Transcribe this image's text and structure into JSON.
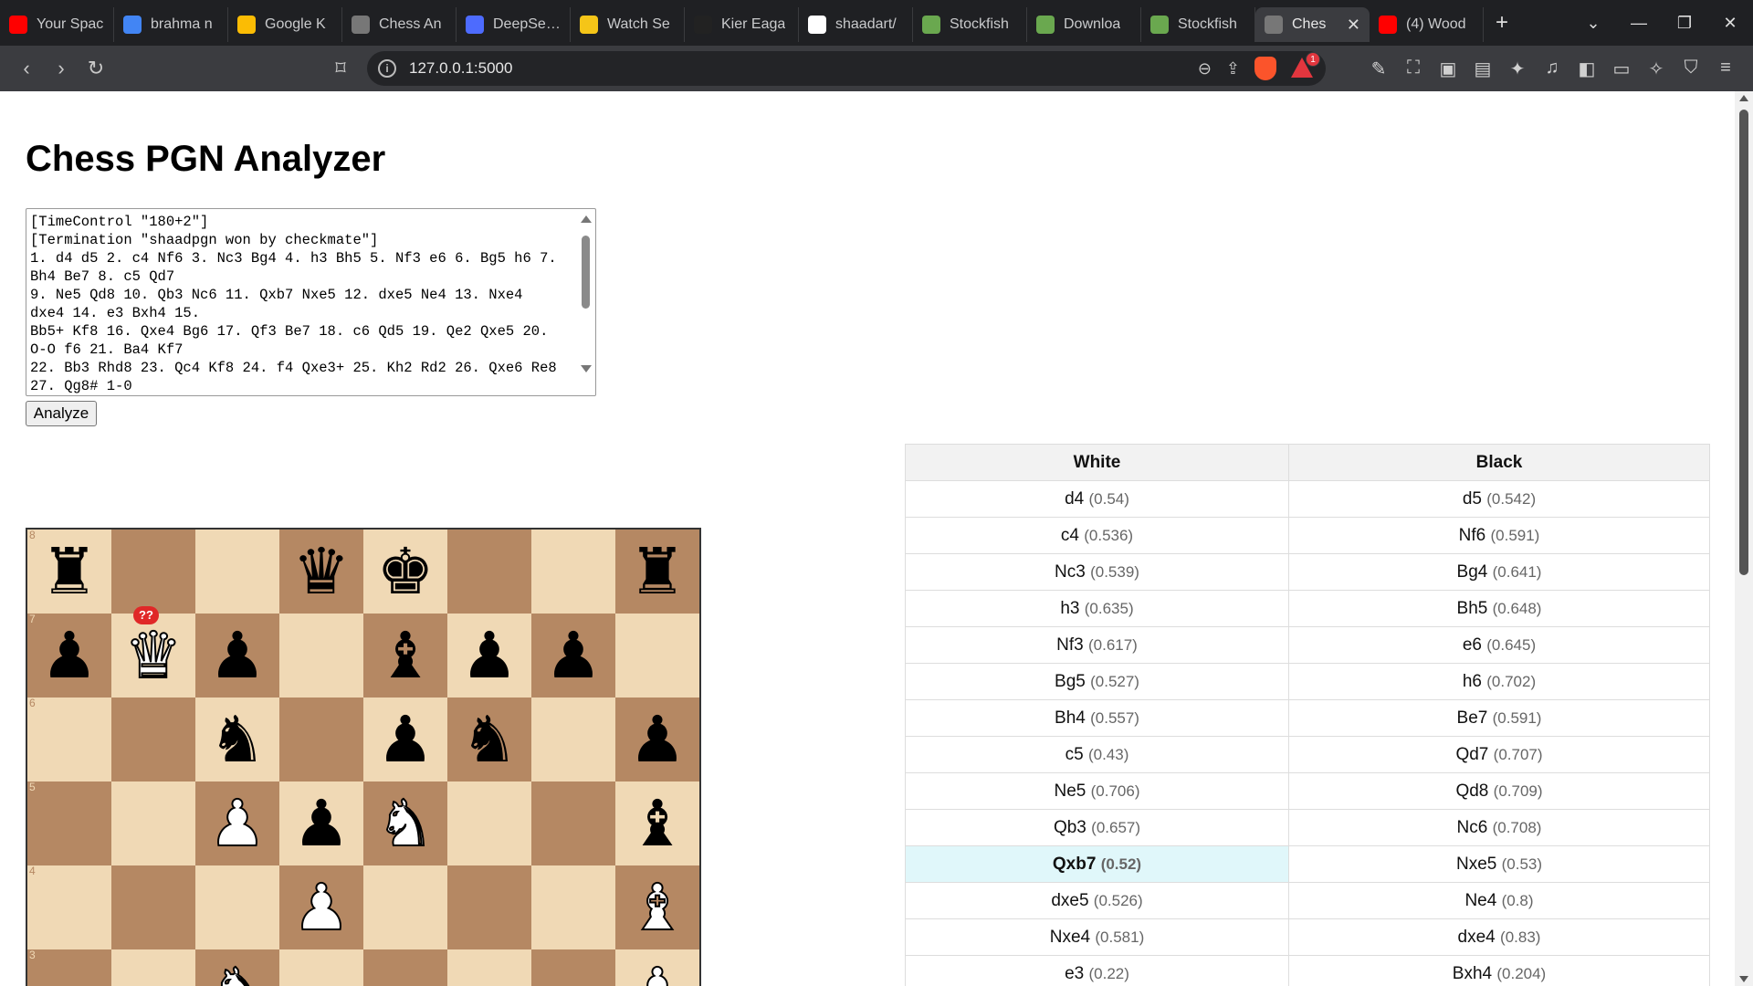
{
  "browser": {
    "tabs": [
      {
        "label": "Your Spac",
        "icon": "youtube-icon",
        "color": "#ff0000"
      },
      {
        "label": "brahma n",
        "icon": "google-icon",
        "color": "#4285f4"
      },
      {
        "label": "Google K",
        "icon": "google-keep-icon",
        "color": "#fbbc04"
      },
      {
        "label": "Chess An",
        "icon": "globe-icon",
        "color": "#777777"
      },
      {
        "label": "DeepSeek",
        "icon": "deepseek-icon",
        "color": "#4d6bfe"
      },
      {
        "label": "Watch Se",
        "icon": "watch-icon",
        "color": "#f5c518"
      },
      {
        "label": "Kier Eaga",
        "icon": "drop-icon",
        "color": "#222222"
      },
      {
        "label": "shaadart/",
        "icon": "github-icon",
        "color": "#ffffff"
      },
      {
        "label": "Stockfish",
        "icon": "stockfish-icon",
        "color": "#6aa84f"
      },
      {
        "label": "Downloa",
        "icon": "stockfish-icon",
        "color": "#6aa84f"
      },
      {
        "label": "Stockfish",
        "icon": "stockfish-icon",
        "color": "#6aa84f"
      },
      {
        "label": "Ches",
        "icon": "globe-icon",
        "color": "#777777",
        "active": true
      },
      {
        "label": "(4) Wood",
        "icon": "youtube-icon",
        "color": "#ff0000"
      }
    ],
    "url": "127.0.0.1:5000",
    "rewards_badge": "1"
  },
  "page": {
    "title": "Chess PGN Analyzer",
    "pgn_text": "[TimeControl \"180+2\"]\n[Termination \"shaadpgn won by checkmate\"]\n1. d4 d5 2. c4 Nf6 3. Nc3 Bg4 4. h3 Bh5 5. Nf3 e6 6. Bg5 h6 7.\nBh4 Be7 8. c5 Qd7\n9. Ne5 Qd8 10. Qb3 Nc6 11. Qxb7 Nxe5 12. dxe5 Ne4 13. Nxe4\ndxe4 14. e3 Bxh4 15.\nBb5+ Kf8 16. Qxe4 Bg6 17. Qf3 Be7 18. c6 Qd5 19. Qe2 Qxe5 20.\nO-O f6 21. Ba4 Kf7\n22. Bb3 Rhd8 23. Qc4 Kf8 24. f4 Qxe3+ 25. Kh2 Rd2 26. Qxe6 Re8\n27. Qg8# 1-0",
    "analyze_label": "Analyze",
    "blunder_badge": "??"
  },
  "board": {
    "ranks_visible": [
      8,
      7,
      6,
      5,
      4,
      3
    ],
    "rows": [
      [
        "bR",
        "",
        "",
        "bQ",
        "bK",
        "",
        "",
        "bR"
      ],
      [
        "bP",
        "wQ",
        "bP",
        "",
        "bB",
        "bP",
        "bP",
        ""
      ],
      [
        "",
        "",
        "bN",
        "",
        "bP",
        "bN",
        "",
        "bP"
      ],
      [
        "",
        "",
        "wP",
        "bP",
        "wN",
        "",
        "",
        "bB"
      ],
      [
        "",
        "",
        "",
        "wP",
        "",
        "",
        "",
        "wB"
      ],
      [
        "",
        "",
        "wN",
        "",
        "",
        "",
        "",
        "wP"
      ]
    ]
  },
  "moves_table": {
    "headers": {
      "white": "White",
      "black": "Black"
    },
    "rows": [
      {
        "white": "d4",
        "white_eval": "(0.54)",
        "black": "d5",
        "black_eval": "(0.542)"
      },
      {
        "white": "c4",
        "white_eval": "(0.536)",
        "black": "Nf6",
        "black_eval": "(0.591)"
      },
      {
        "white": "Nc3",
        "white_eval": "(0.539)",
        "black": "Bg4",
        "black_eval": "(0.641)"
      },
      {
        "white": "h3",
        "white_eval": "(0.635)",
        "black": "Bh5",
        "black_eval": "(0.648)"
      },
      {
        "white": "Nf3",
        "white_eval": "(0.617)",
        "black": "e6",
        "black_eval": "(0.645)"
      },
      {
        "white": "Bg5",
        "white_eval": "(0.527)",
        "black": "h6",
        "black_eval": "(0.702)"
      },
      {
        "white": "Bh4",
        "white_eval": "(0.557)",
        "black": "Be7",
        "black_eval": "(0.591)"
      },
      {
        "white": "c5",
        "white_eval": "(0.43)",
        "black": "Qd7",
        "black_eval": "(0.707)"
      },
      {
        "white": "Ne5",
        "white_eval": "(0.706)",
        "black": "Qd8",
        "black_eval": "(0.709)"
      },
      {
        "white": "Qb3",
        "white_eval": "(0.657)",
        "black": "Nc6",
        "black_eval": "(0.708)"
      },
      {
        "white": "Qxb7",
        "white_eval": "(0.52)",
        "black": "Nxe5",
        "black_eval": "(0.53)",
        "current": "white"
      },
      {
        "white": "dxe5",
        "white_eval": "(0.526)",
        "black": "Ne4",
        "black_eval": "(0.8)"
      },
      {
        "white": "Nxe4",
        "white_eval": "(0.581)",
        "black": "dxe4",
        "black_eval": "(0.83)"
      },
      {
        "white": "e3",
        "white_eval": "(0.22)",
        "black": "Bxh4",
        "black_eval": "(0.204)"
      }
    ]
  },
  "colors": {
    "light_square": "#f0d9b5",
    "dark_square": "#b58863",
    "highlight_row": "#e0f7fa",
    "blunder": "#e02828"
  }
}
